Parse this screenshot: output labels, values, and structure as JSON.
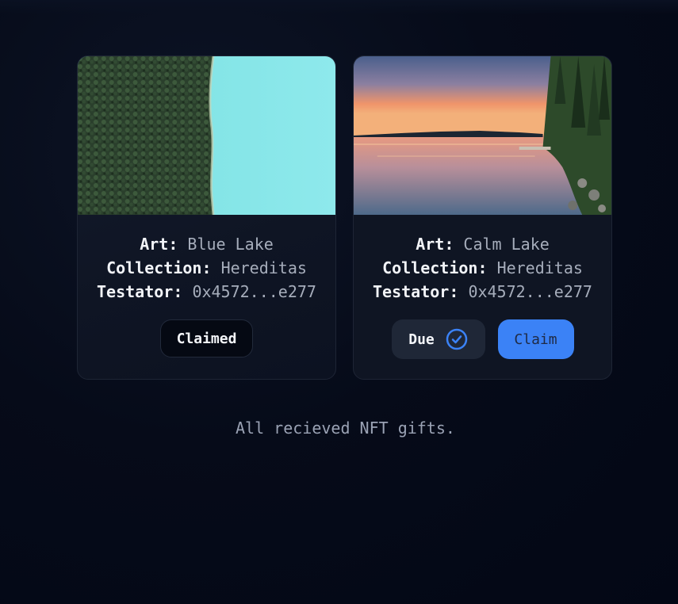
{
  "cards": [
    {
      "art_label": "Art:",
      "art_value": "Blue Lake",
      "collection_label": "Collection:",
      "collection_value": "Hereditas",
      "testator_label": "Testator:",
      "testator_value": "0x4572...e277",
      "status_button": "Claimed"
    },
    {
      "art_label": "Art:",
      "art_value": "Calm Lake",
      "collection_label": "Collection:",
      "collection_value": "Hereditas",
      "testator_label": "Testator:",
      "testator_value": "0x4572...e277",
      "due_label": "Due",
      "due_icon": "check-circle-icon",
      "claim_button": "Claim"
    }
  ],
  "footer": {
    "text": "All recieved NFT gifts."
  },
  "colors": {
    "background": "#060b19",
    "accent": "#3b82f6",
    "card_border": "#1e2535"
  }
}
